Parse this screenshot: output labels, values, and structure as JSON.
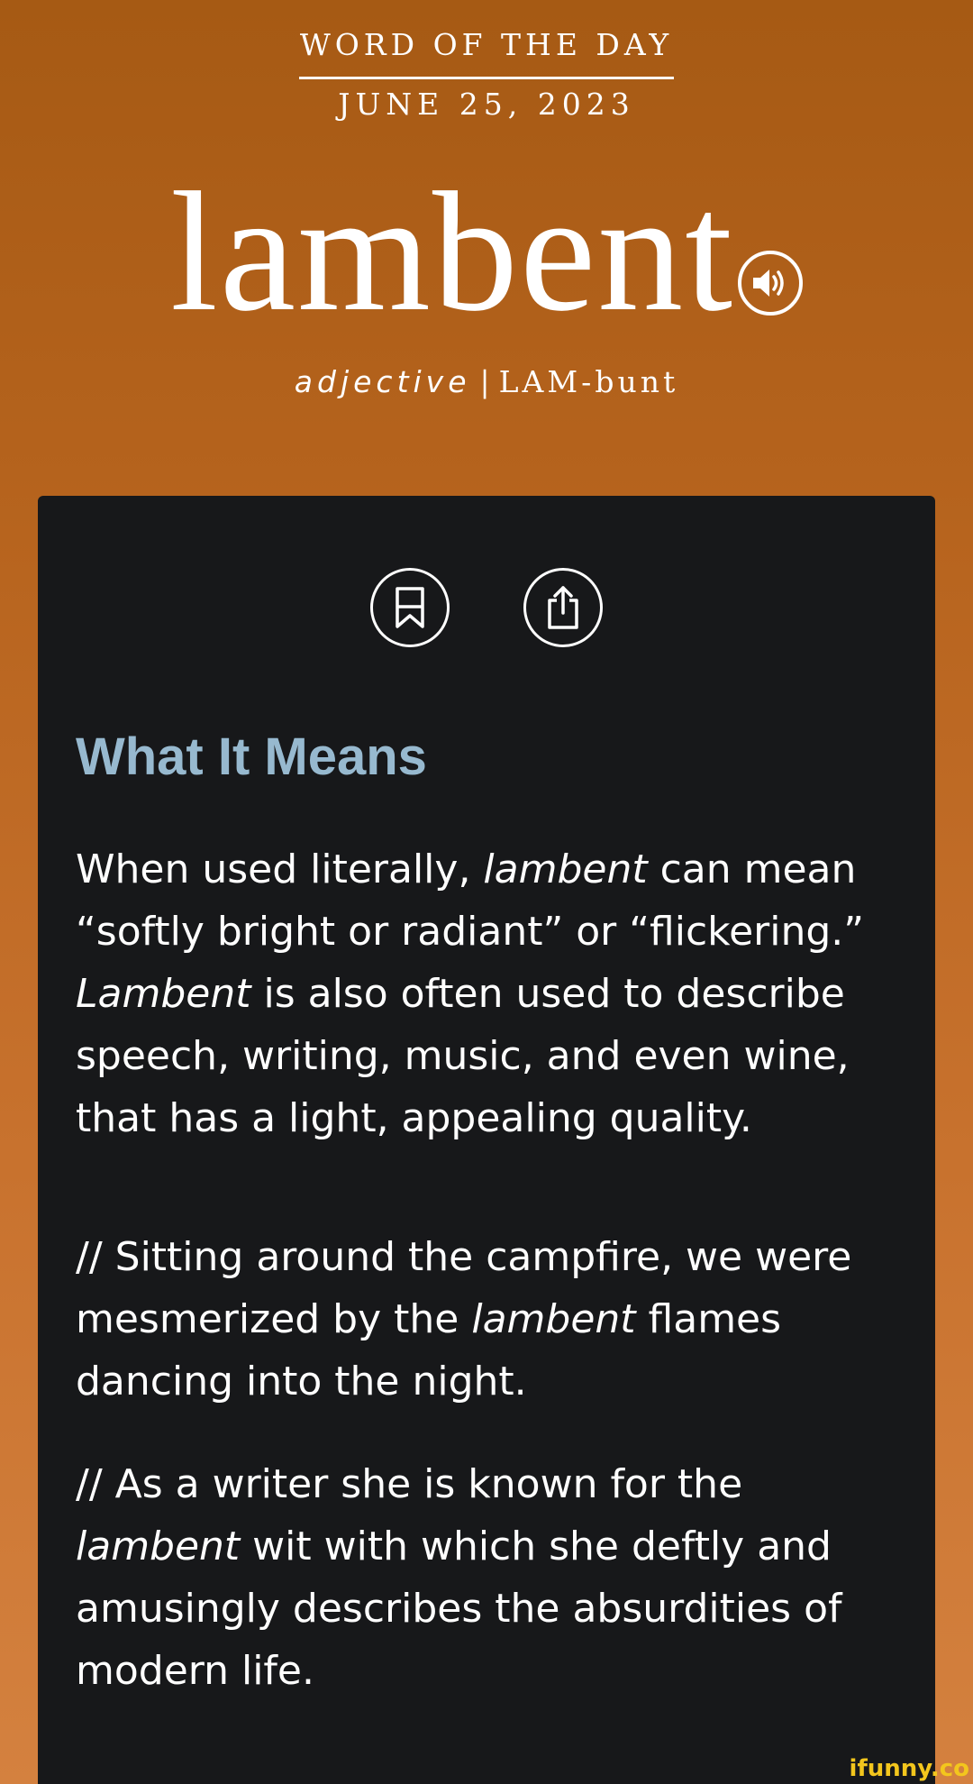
{
  "header": {
    "kicker": "WORD OF THE DAY",
    "date": "JUNE 25, 2023",
    "word": "lambent",
    "part_of_speech": "adjective",
    "separator": "|",
    "pronunciation": "LAM-bunt",
    "audio_icon": "speaker-icon"
  },
  "actions": {
    "save_icon": "bookmark-icon",
    "share_icon": "share-icon"
  },
  "definition": {
    "title": "What It Means",
    "p1_a": "When used literally, ",
    "p1_b": "lambent",
    "p1_c": " can mean “softly bright or radiant” or “flickering.” ",
    "p1_d": "Lambent",
    "p1_e": " is also often used to describe speech, writing, music, and even wine, that has a light, appealing quality.",
    "ex1_a": "// Sitting around the campfire, we were mesmerized by the ",
    "ex1_b": "lambent",
    "ex1_c": " flames dancing into the night.",
    "ex2_a": "// As a writer she is known for the ",
    "ex2_b": "lambent",
    "ex2_c": " wit with which she deftly and amusingly describes the absurdities of modern life."
  },
  "watermark": "ifunny.co",
  "colors": {
    "header_top": "#a65a14",
    "header_bottom": "#d4813f",
    "card_bg": "#17181a",
    "title_color": "#97b9cf",
    "text": "#ffffff"
  }
}
